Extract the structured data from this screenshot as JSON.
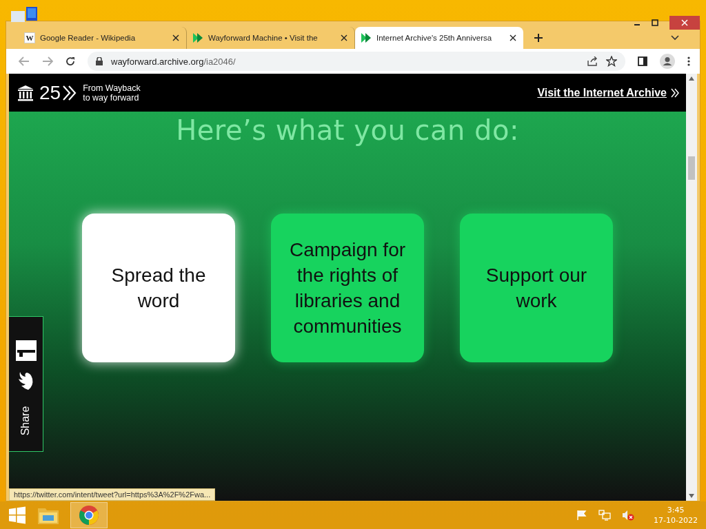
{
  "browser": {
    "tabs": [
      {
        "title": "Google Reader - Wikipedia",
        "kind": "wikipedia",
        "icon_letter": "W",
        "selected": false
      },
      {
        "title": "Wayforward Machine • Visit the ",
        "kind": "arrow",
        "selected": false
      },
      {
        "title": "Internet Archive's 25th Anniversa",
        "kind": "arrow",
        "selected": true
      }
    ],
    "url_host": "wayforward.archive.org",
    "url_path": "/ia2046/",
    "status_url": "https://twitter.com/intent/tweet?url=https%3A%2F%2Fwa..."
  },
  "site_header": {
    "logo_text": "25",
    "tagline": [
      "From Wayback",
      "to way forward"
    ],
    "link": "Visit the Internet Archive"
  },
  "heading": "Here’s what you can do:",
  "cards": [
    {
      "label": "Spread the word",
      "selected": true
    },
    {
      "label": "Campaign for the rights of libraries and communities",
      "selected": false
    },
    {
      "label": "Support our work",
      "selected": false
    }
  ],
  "share": {
    "label": "Share"
  },
  "taskbar": {
    "time": "3:45",
    "date": "17-10-2022"
  }
}
